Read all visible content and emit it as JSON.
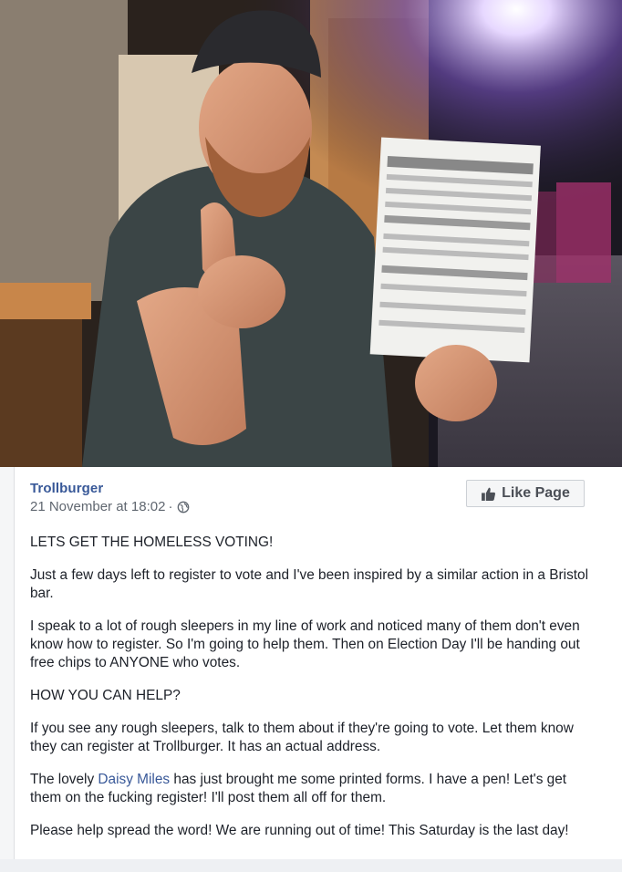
{
  "post": {
    "author": "Trollburger",
    "timestamp": "21 November at 18:02",
    "separator": "·",
    "privacy_icon": "globe-icon",
    "like_button_label": "Like Page",
    "paragraphs": [
      "LETS GET THE HOMELESS VOTING!",
      "Just a few days left to register to vote and I've been inspired by a similar action in a Bristol bar.",
      "I speak to a lot of rough sleepers in my line of work and noticed many of them don't even know how to register. So I'm going to help them. Then on Election Day I'll be handing out free chips to ANYONE who votes.",
      "HOW YOU CAN HELP?",
      "If you see any rough sleepers, talk to them about if they're going to vote. Let them know they can register at Trollburger. It has an actual address."
    ],
    "paragraph6": {
      "before": "The lovely ",
      "mention": "Daisy Miles",
      "after": " has just brought me some printed forms. I have a pen! Let's get them on the fucking register! I'll post them all off for them."
    },
    "paragraph7": "Please help spread the word! We are running out of time! This Saturday is the last day!"
  },
  "colors": {
    "link": "#385898",
    "text": "#1d2129",
    "meta": "#606770"
  }
}
